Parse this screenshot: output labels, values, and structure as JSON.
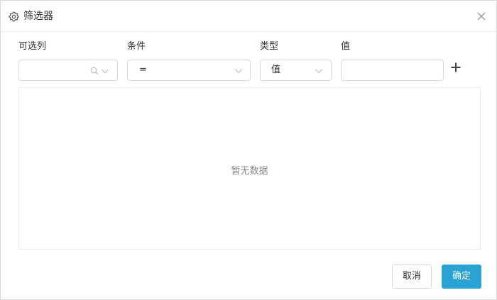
{
  "dialog": {
    "title": "筛选器",
    "icon": "gear-icon",
    "close_icon": "close-icon"
  },
  "columns": {
    "available": "可选列",
    "condition": "条件",
    "type": "类型",
    "value": "值"
  },
  "fields": {
    "available_value": "",
    "condition_value": "=",
    "type_value": "值",
    "value_value": ""
  },
  "table": {
    "empty_text": "暂无数据"
  },
  "buttons": {
    "cancel": "取消",
    "confirm": "确定"
  },
  "colors": {
    "primary": "#2aa3d4",
    "border": "#d9d9d9",
    "muted_text": "#888888"
  }
}
